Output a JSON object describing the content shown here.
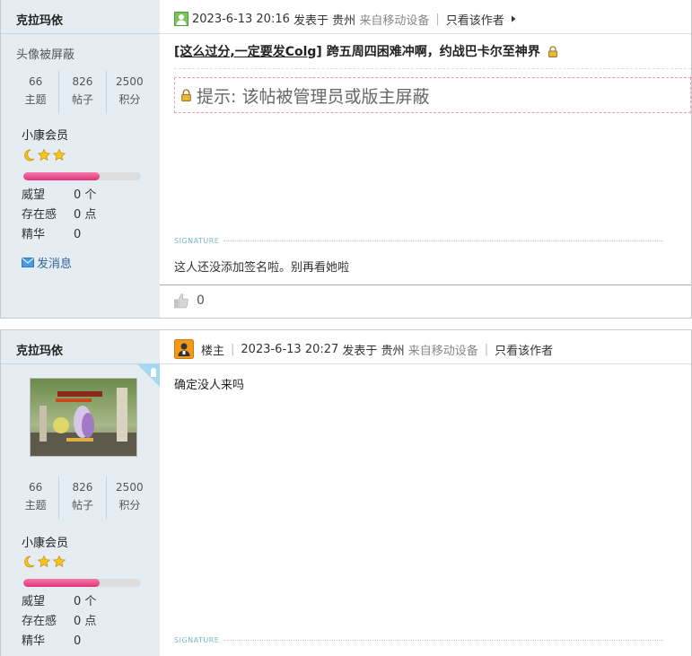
{
  "posts": [
    {
      "username": "克拉玛依",
      "avatar_text": "头像被屏蔽",
      "stats": [
        {
          "value": "66",
          "label": "主题"
        },
        {
          "value": "826",
          "label": "帖子"
        },
        {
          "value": "2500",
          "label": "积分"
        }
      ],
      "rank": "小康会员",
      "level_progress": 0.65,
      "info": [
        {
          "key": "威望",
          "value": "0 个"
        },
        {
          "key": "存在感",
          "value": "0 点"
        },
        {
          "key": "精华",
          "value": "0"
        }
      ],
      "message_link": "发消息",
      "header": {
        "datetime": "2023-6-13 20:16",
        "posted_in": "发表于",
        "location": "贵州",
        "device": "来自移动设备",
        "only_author": "只看该作者"
      },
      "title": {
        "category": "[这么过分,一定要发Colg]",
        "text": "跨五周四困难冲啊，约战巴卡尔至神界"
      },
      "notice": "提示: 该帖被管理员或版主屏蔽",
      "signature_label": "SIGNATURE",
      "signature": "这人还没添加签名啦。别再看她啦",
      "likes": "0"
    },
    {
      "username": "克拉玛依",
      "stats": [
        {
          "value": "66",
          "label": "主题"
        },
        {
          "value": "826",
          "label": "帖子"
        },
        {
          "value": "2500",
          "label": "积分"
        }
      ],
      "rank": "小康会员",
      "level_progress": 0.65,
      "info": [
        {
          "key": "威望",
          "value": "0 个"
        },
        {
          "key": "存在感",
          "value": "0 点"
        },
        {
          "key": "精华",
          "value": "0"
        }
      ],
      "header": {
        "floor": "楼主",
        "datetime": "2023-6-13 20:27",
        "posted_in": "发表于",
        "location": "贵州",
        "device": "来自移动设备",
        "only_author": "只看该作者"
      },
      "content": "确定没人来吗",
      "signature_label": "SIGNATURE"
    }
  ],
  "colors": {
    "sidebar_bg": "#e5edf2",
    "level_bar": "#e0357a",
    "link": "#336699",
    "signature": "#7ab7c9"
  }
}
